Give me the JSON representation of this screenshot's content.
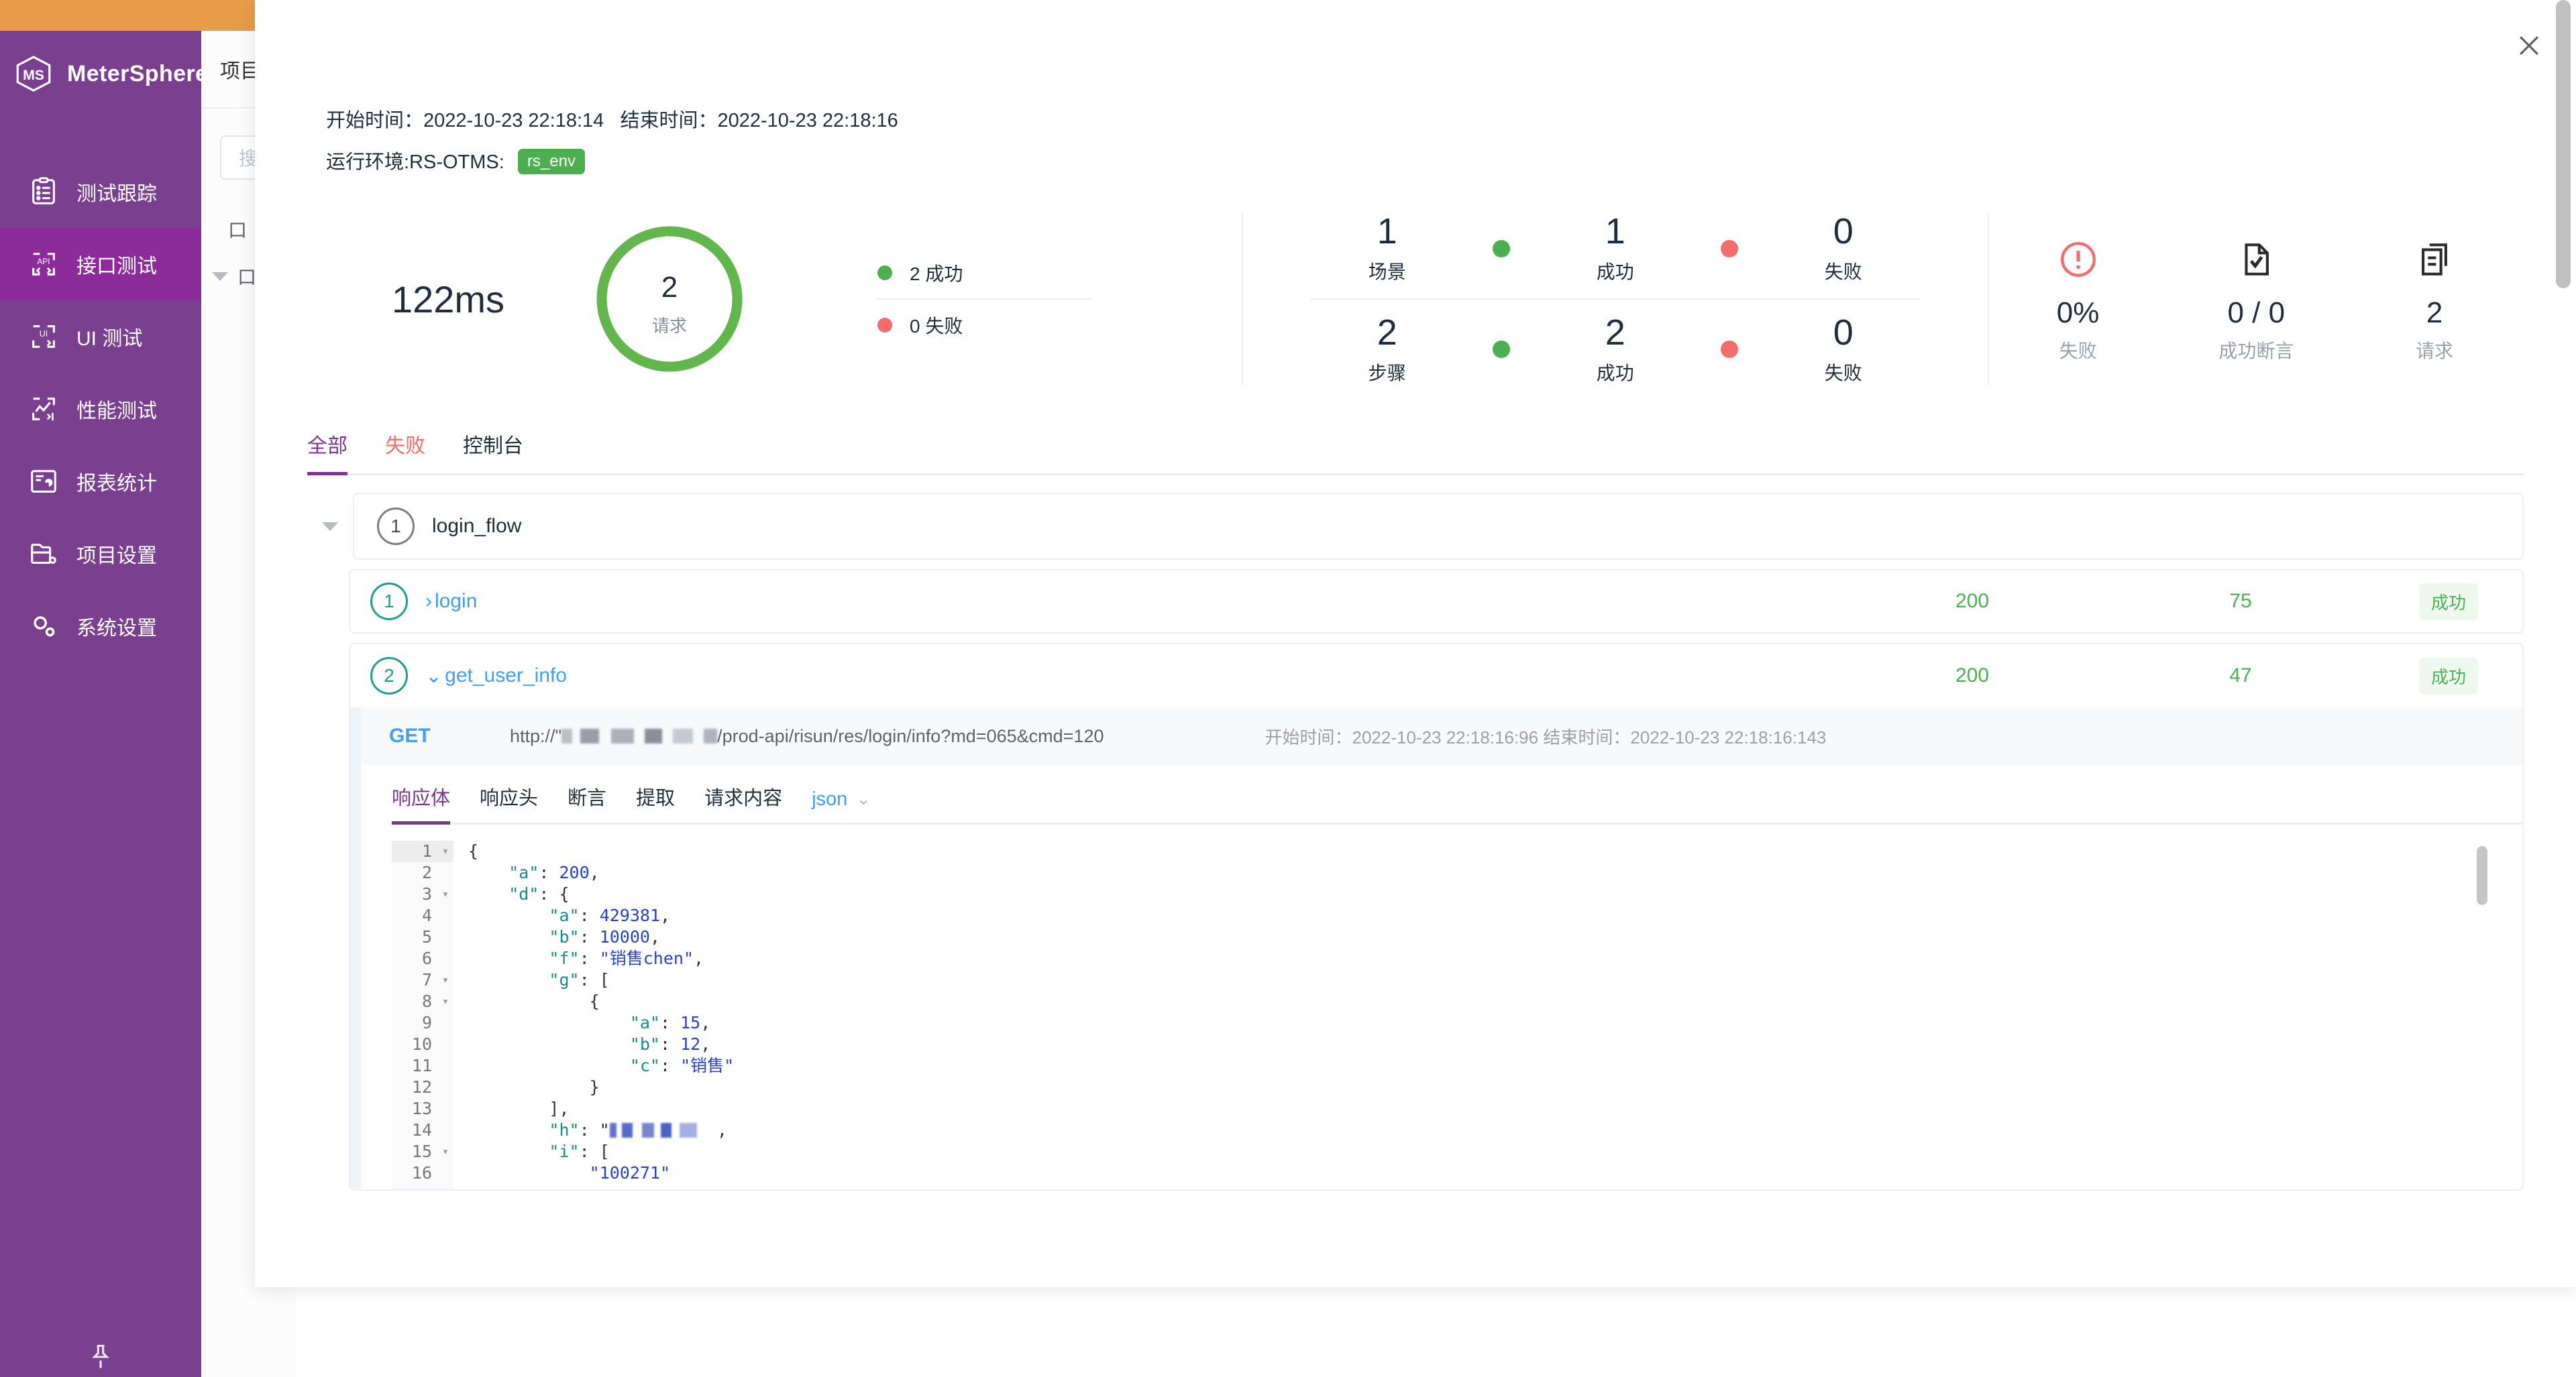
{
  "sidebar": {
    "brand": "MeterSphere",
    "items": [
      {
        "label": "测试跟踪",
        "icon": "clipboard-icon"
      },
      {
        "label": "接口测试",
        "icon": "api-icon"
      },
      {
        "label": "UI 测试",
        "icon": "ui-icon"
      },
      {
        "label": "性能测试",
        "icon": "performance-icon"
      },
      {
        "label": "报表统计",
        "icon": "report-icon"
      },
      {
        "label": "项目设置",
        "icon": "folder-settings-icon"
      },
      {
        "label": "系统设置",
        "icon": "gear-icon"
      }
    ],
    "pin_icon": "pin-icon"
  },
  "background": {
    "header_title": "项目",
    "search_placeholder": "搜",
    "tree_item_1": "口",
    "tree_item_2": "口"
  },
  "modal": {
    "close_icon": "close-icon",
    "info": {
      "start_label": "开始时间：",
      "start_time": "2022-10-23 22:18:14",
      "end_label": "结束时间：",
      "end_time": "2022-10-23 22:18:16",
      "env_label": "运行环境:RS-OTMS:",
      "env_value": "rs_env"
    },
    "stats": {
      "response_time": "122ms",
      "donut_value": "2",
      "donut_label": "请求",
      "donut_color": "#62b64d",
      "legend": [
        {
          "dot": "#4caf50",
          "text": "2 成功"
        },
        {
          "dot": "#f56c6c",
          "text": "0 失败"
        }
      ],
      "mid_rows": [
        {
          "total": "1",
          "total_label": "场景",
          "success": "1",
          "success_label": "成功",
          "fail": "0",
          "fail_label": "失败"
        },
        {
          "total": "2",
          "total_label": "步骤",
          "success": "2",
          "success_label": "成功",
          "fail": "0",
          "fail_label": "失败"
        }
      ],
      "right_cells": [
        {
          "icon": "error-circle-icon",
          "value": "0%",
          "label": "失败",
          "color": "#f56c6c"
        },
        {
          "icon": "document-check-icon",
          "value": "0 / 0",
          "label": "成功断言",
          "color": "#1f2d3d"
        },
        {
          "icon": "copy-document-icon",
          "value": "2",
          "label": "请求",
          "color": "#1f2d3d"
        }
      ]
    },
    "tabs": [
      {
        "label": "全部",
        "state": "active"
      },
      {
        "label": "失败",
        "state": "fail"
      },
      {
        "label": "控制台",
        "state": "normal"
      }
    ],
    "scenario": {
      "index": "1",
      "name": "login_flow"
    },
    "requests": [
      {
        "index": "1",
        "chevron": "›",
        "name": "login",
        "code": "200",
        "response_time": "75",
        "status": "成功",
        "expanded": false
      },
      {
        "index": "2",
        "chevron": "⌄",
        "name": "get_user_info",
        "code": "200",
        "response_time": "47",
        "status": "成功",
        "expanded": true
      }
    ],
    "detail": {
      "method": "GET",
      "url_prefix": "http://\"",
      "url_suffix": "/prod-api/risun/res/login/info?md=065&cmd=120",
      "start_label": "开始时间：",
      "start_time": "2022-10-23 22:18:16:96",
      "end_label": "结束时间：",
      "end_time": "2022-10-23 22:18:16:143",
      "sub_tabs": [
        {
          "label": "响应体",
          "state": "active"
        },
        {
          "label": "响应头",
          "state": "normal"
        },
        {
          "label": "断言",
          "state": "normal"
        },
        {
          "label": "提取",
          "state": "normal"
        },
        {
          "label": "请求内容",
          "state": "normal"
        }
      ],
      "format_select": "json",
      "format_caret": "chevron-down-icon",
      "code_lines": [
        {
          "no": "1",
          "fold": "▾",
          "indent": 0,
          "tokens": [
            {
              "t": "{",
              "c": "p"
            }
          ]
        },
        {
          "no": "2",
          "fold": "",
          "indent": 2,
          "tokens": [
            {
              "t": "\"a\"",
              "c": "k"
            },
            {
              "t": ": ",
              "c": "p"
            },
            {
              "t": "200",
              "c": "n"
            },
            {
              "t": ",",
              "c": "p"
            }
          ]
        },
        {
          "no": "3",
          "fold": "▾",
          "indent": 2,
          "tokens": [
            {
              "t": "\"d\"",
              "c": "k"
            },
            {
              "t": ": {",
              "c": "p"
            }
          ]
        },
        {
          "no": "4",
          "fold": "",
          "indent": 4,
          "tokens": [
            {
              "t": "\"a\"",
              "c": "k"
            },
            {
              "t": ": ",
              "c": "p"
            },
            {
              "t": "429381",
              "c": "n"
            },
            {
              "t": ",",
              "c": "p"
            }
          ]
        },
        {
          "no": "5",
          "fold": "",
          "indent": 4,
          "tokens": [
            {
              "t": "\"b\"",
              "c": "k"
            },
            {
              "t": ": ",
              "c": "p"
            },
            {
              "t": "10000",
              "c": "n"
            },
            {
              "t": ",",
              "c": "p"
            }
          ]
        },
        {
          "no": "6",
          "fold": "",
          "indent": 4,
          "tokens": [
            {
              "t": "\"f\"",
              "c": "k"
            },
            {
              "t": ": ",
              "c": "p"
            },
            {
              "t": "\"销售chen\"",
              "c": "s"
            },
            {
              "t": ",",
              "c": "p"
            }
          ]
        },
        {
          "no": "7",
          "fold": "▾",
          "indent": 4,
          "tokens": [
            {
              "t": "\"g\"",
              "c": "k"
            },
            {
              "t": ": [",
              "c": "p"
            }
          ]
        },
        {
          "no": "8",
          "fold": "▾",
          "indent": 6,
          "tokens": [
            {
              "t": "{",
              "c": "p"
            }
          ]
        },
        {
          "no": "9",
          "fold": "",
          "indent": 8,
          "tokens": [
            {
              "t": "\"a\"",
              "c": "k"
            },
            {
              "t": ": ",
              "c": "p"
            },
            {
              "t": "15",
              "c": "n"
            },
            {
              "t": ",",
              "c": "p"
            }
          ]
        },
        {
          "no": "10",
          "fold": "",
          "indent": 8,
          "tokens": [
            {
              "t": "\"b\"",
              "c": "k"
            },
            {
              "t": ": ",
              "c": "p"
            },
            {
              "t": "12",
              "c": "n"
            },
            {
              "t": ",",
              "c": "p"
            }
          ]
        },
        {
          "no": "11",
          "fold": "",
          "indent": 8,
          "tokens": [
            {
              "t": "\"c\"",
              "c": "k"
            },
            {
              "t": ": ",
              "c": "p"
            },
            {
              "t": "\"销售\"",
              "c": "s"
            }
          ]
        },
        {
          "no": "12",
          "fold": "",
          "indent": 6,
          "tokens": [
            {
              "t": "}",
              "c": "p"
            }
          ]
        },
        {
          "no": "13",
          "fold": "",
          "indent": 4,
          "tokens": [
            {
              "t": "],",
              "c": "p"
            }
          ]
        },
        {
          "no": "14",
          "fold": "",
          "indent": 4,
          "tokens": [
            {
              "t": "\"h\"",
              "c": "k"
            },
            {
              "t": ": \"",
              "c": "p"
            },
            {
              "t": "__BLUR__",
              "c": "blur"
            },
            {
              "t": "  ,",
              "c": "p"
            }
          ]
        },
        {
          "no": "15",
          "fold": "▾",
          "indent": 4,
          "tokens": [
            {
              "t": "\"i\"",
              "c": "k"
            },
            {
              "t": ": [",
              "c": "p"
            }
          ]
        },
        {
          "no": "16",
          "fold": "",
          "indent": 6,
          "tokens": [
            {
              "t": "\"100271\"",
              "c": "s"
            }
          ]
        }
      ]
    }
  }
}
